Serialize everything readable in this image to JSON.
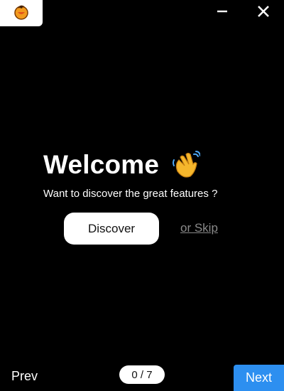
{
  "titlebar": {
    "app_icon": "app-logo-icon",
    "minimize_icon": "minimize-icon",
    "close_icon": "close-icon"
  },
  "welcome": {
    "title": "Welcome",
    "emoji_icon": "waving-hand-icon",
    "subtitle": "Want to discover the great features ?"
  },
  "actions": {
    "discover_label": "Discover",
    "skip_label": "or Skip"
  },
  "footer": {
    "prev_label": "Prev",
    "page_indicator": "0 / 7",
    "next_label": "Next"
  },
  "colors": {
    "background": "#000000",
    "next_button": "#2d8ff0",
    "skip_link": "#8a8a8a"
  }
}
